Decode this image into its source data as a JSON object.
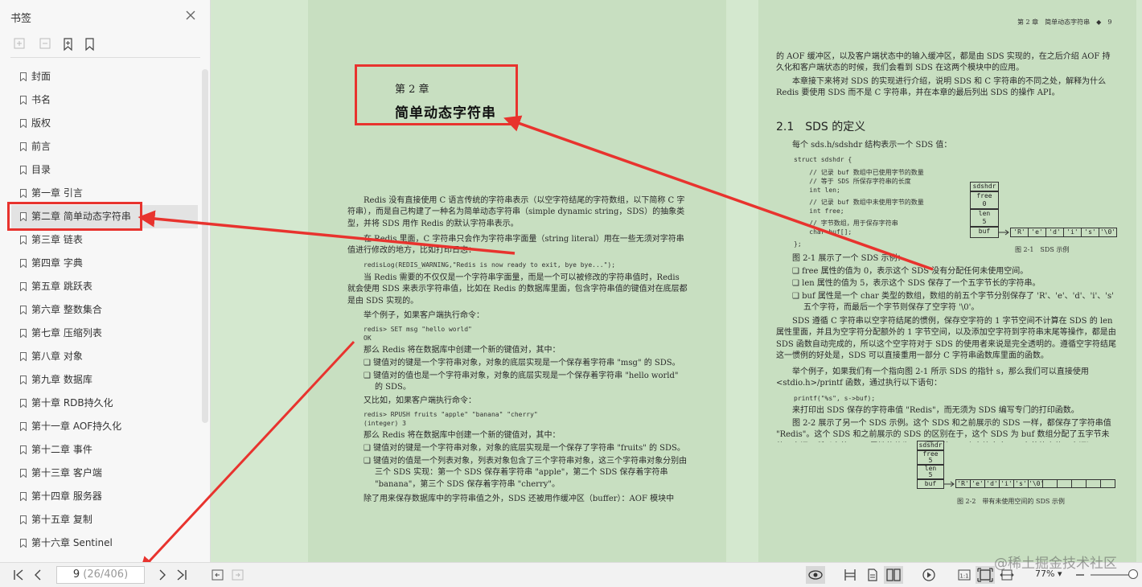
{
  "sidebar": {
    "title": "书签",
    "tools": [
      "expand-all-icon",
      "collapse-all-icon",
      "add-bookmark-icon",
      "bookmark-icon"
    ],
    "items": [
      {
        "label": "封面"
      },
      {
        "label": "书名"
      },
      {
        "label": "版权"
      },
      {
        "label": "前言"
      },
      {
        "label": "目录"
      },
      {
        "label": "第一章 引言"
      },
      {
        "label": "第二章 简单动态字符串",
        "selected": true
      },
      {
        "label": "第三章 链表"
      },
      {
        "label": "第四章 字典"
      },
      {
        "label": "第五章 跳跃表"
      },
      {
        "label": "第六章 整数集合"
      },
      {
        "label": "第七章 压缩列表"
      },
      {
        "label": "第八章 对象"
      },
      {
        "label": "第九章 数据库"
      },
      {
        "label": "第十章 RDB持久化"
      },
      {
        "label": "第十一章 AOF持久化"
      },
      {
        "label": "第十二章 事件"
      },
      {
        "label": "第十三章 客户端"
      },
      {
        "label": "第十四章 服务器"
      },
      {
        "label": "第十五章 复制"
      },
      {
        "label": "第十六章 Sentinel"
      }
    ]
  },
  "left_page": {
    "chapter_num": "第 2 章",
    "chapter_title": "简单动态字符串",
    "para1": "Redis 没有直接使用 C 语言传统的字符串表示（以空字符结尾的字符数组，以下简称 C 字符串），而是自己构建了一种名为简单动态字符串（simple dynamic string，SDS）的抽象类型，并将 SDS 用作 Redis 的默认字符串表示。",
    "para2": "在 Redis 里面，C 字符串只会作为字符串字面量（string literal）用在一些无须对字符串值进行修改的地方，比如打印日志：",
    "code1": "redisLog(REDIS_WARNING,\"Redis is now ready to exit, bye bye...\");",
    "para3": "当 Redis 需要的不仅仅是一个字符串字面量，而是一个可以被修改的字符串值时，Redis 就会使用 SDS 来表示字符串值，比如在 Redis 的数据库里面，包含字符串值的键值对在底层都是由 SDS 实现的。",
    "para4": "举个例子，如果客户端执行命令：",
    "code2a": "redis> SET msg \"hello world\"",
    "code2b": "OK",
    "para5": "那么 Redis 将在数据库中创建一个新的键值对，其中：",
    "bullet1": "键值对的键是一个字符串对象，对象的底层实现是一个保存着字符串 \"msg\" 的 SDS。",
    "bullet2": "键值对的值也是一个字符串对象，对象的底层实现是一个保存着字符串 \"hello world\" 的 SDS。",
    "para6": "又比如，如果客户端执行命令：",
    "code3a": "redis> RPUSH fruits \"apple\" \"banana\" \"cherry\"",
    "code3b": "(integer) 3",
    "para7": "那么 Redis 将在数据库中创建一个新的键值对，其中：",
    "bullet3": "键值对的键是一个字符串对象，对象的底层实现是一个保存了字符串 \"fruits\" 的 SDS。",
    "bullet4": "键值对的值是一个列表对象，列表对象包含了三个字符串对象，这三个字符串对象分别由三个 SDS 实现：第一个 SDS 保存着字符串 \"apple\"，第二个 SDS 保存着字符串 \"banana\"，第三个 SDS 保存着字符串 \"cherry\"。",
    "para8": "除了用来保存数据库中的字符串值之外，SDS 还被用作缓冲区（buffer）：AOF 模块中"
  },
  "right_page": {
    "running_head": "第 2 章　简单动态字符串　◆　9",
    "para1": "的 AOF 缓冲区，以及客户端状态中的输入缓冲区，都是由 SDS 实现的，在之后介绍 AOF 持久化和客户端状态的时候，我们会看到 SDS 在这两个模块中的应用。",
    "para2": "本章接下来将对 SDS 的实现进行介绍，说明 SDS 和 C 字符串的不同之处，解释为什么 Redis 要使用 SDS 而不是 C 字符串，并在本章的最后列出 SDS 的操作 API。",
    "section": "2.1　SDS 的定义",
    "para3": "每个 sds.h/sdshdr 结构表示一个 SDS 值：",
    "struct_lines": [
      "struct sdshdr {",
      "    // 记录 buf 数组中已使用字节的数量",
      "    // 等于 SDS 所保存字符串的长度",
      "    int len;",
      "    // 记录 buf 数组中未使用字节的数量",
      "    int free;",
      "    // 字节数组，用于保存字符串",
      "    char buf[];",
      "};"
    ],
    "fig1": {
      "hdr": "sdshdr",
      "free_lbl": "free",
      "free_val": "0",
      "len_lbl": "len",
      "len_val": "5",
      "buf_lbl": "buf",
      "chars": [
        "'R'",
        "'e'",
        "'d'",
        "'i'",
        "'s'",
        "'\\0'"
      ],
      "caption": "图 2-1　SDS 示例"
    },
    "para4": "图 2-1 展示了一个 SDS 示例：",
    "bullet1": "free 属性的值为 0，表示这个 SDS 没有分配任何未使用空间。",
    "bullet2": "len 属性的值为 5，表示这个 SDS 保存了一个五字节长的字符串。",
    "bullet3": "buf 属性是一个 char 类型的数组，数组的前五个字节分别保存了 'R'、'e'、'd'、'i'、's' 五个字符，而最后一个字节则保存了空字符 '\\0'。",
    "para5": "SDS 遵循 C 字符串以空字符结尾的惯例，保存空字符的 1 字节空间不计算在 SDS 的 len 属性里面，并且为空字符分配额外的 1 字节空间，以及添加空字符到字符串末尾等操作，都是由 SDS 函数自动完成的，所以这个空字符对于 SDS 的使用者来说是完全透明的。遵循空字符结尾这一惯例的好处是，SDS 可以直接重用一部分 C 字符串函数库里面的函数。",
    "para6": "举个例子，如果我们有一个指向图 2-1 所示 SDS 的指针 s，那么我们可以直接使用 <stdio.h>/printf 函数，通过执行以下语句：",
    "code1": "printf(\"%s\", s->buf);",
    "para7": "来打印出 SDS 保存的字符串值 \"Redis\"，而无须为 SDS 编写专门的打印函数。",
    "para8": "图 2-2 展示了另一个 SDS 示例。这个 SDS 和之前展示的 SDS 一样，都保存了字符串值 \"Redis\"。这个 SDS 和之前展示的 SDS 的区别在于，这个 SDS 为 buf 数组分配了五字节未使用空间，所以它的 free 属性的值为 5（图中使用五个空格来表示五字节的未使用空间）。",
    "fig2": {
      "hdr": "sdshdr",
      "free_lbl": "free",
      "free_val": "5",
      "len_lbl": "len",
      "len_val": "5",
      "buf_lbl": "buf",
      "chars": [
        "'R'",
        "'e'",
        "'d'",
        "'i'",
        "'s'",
        "'\\0'",
        "",
        "",
        "",
        "",
        ""
      ],
      "caption": "图 2-2　带有未使用空间的 SDS 示例"
    }
  },
  "toolbar": {
    "page_current": "9",
    "page_total": "(26/406)",
    "zoom": "77%"
  },
  "watermark": "@稀土掘金技术社区",
  "annotation_color": "#e8332e"
}
